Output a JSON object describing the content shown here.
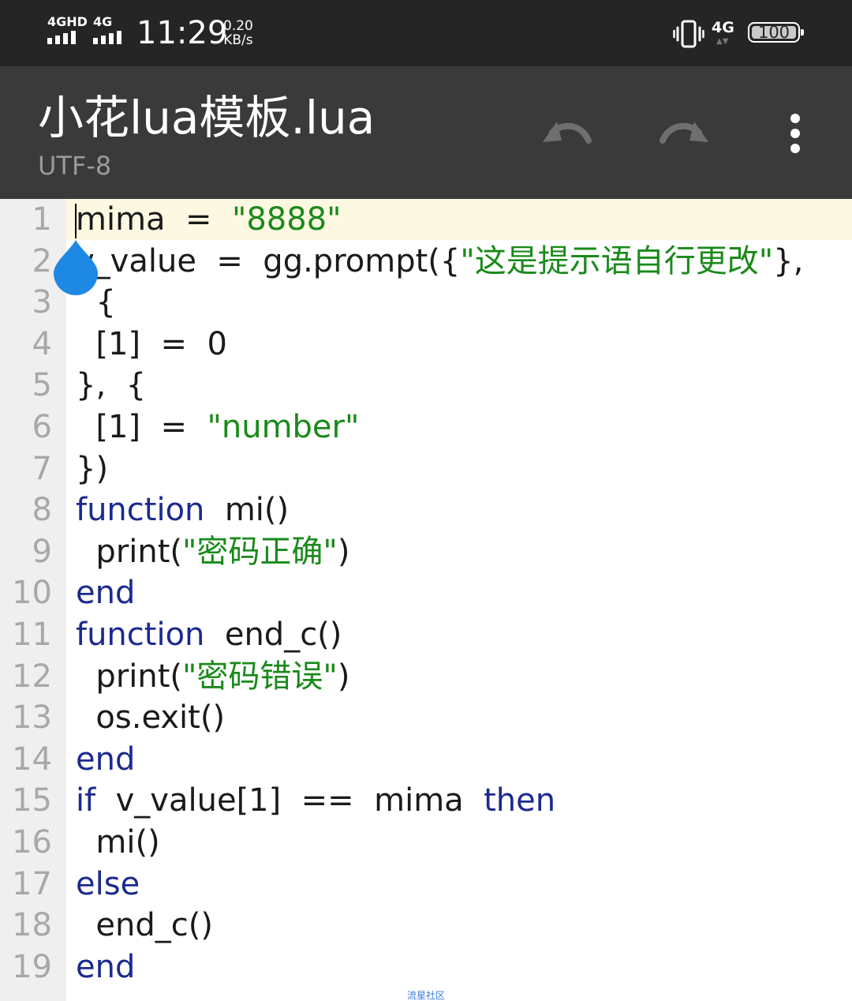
{
  "status_bar": {
    "signal1": "4GHD",
    "signal2": "4G",
    "time": "11:29",
    "speed_value": "0.20",
    "speed_unit": "KB/s",
    "network": "4G",
    "battery": "100"
  },
  "toolbar": {
    "title": "小花lua模板.lua",
    "encoding": "UTF-8",
    "undo_icon": "undo-icon",
    "redo_icon": "redo-icon",
    "more_icon": "more-vert-icon"
  },
  "editor": {
    "current_line": 1,
    "lines": [
      {
        "n": "1",
        "tokens": [
          {
            "t": "mima  =  ",
            "c": "plain"
          },
          {
            "t": "\"8888\"",
            "c": "str"
          }
        ]
      },
      {
        "n": "2",
        "tokens": [
          {
            "t": "v_value  =  gg.prompt({",
            "c": "plain"
          },
          {
            "t": "\"这是提示语自行更改\"",
            "c": "str"
          },
          {
            "t": "},",
            "c": "plain"
          }
        ]
      },
      {
        "n": "3",
        "tokens": [
          {
            "t": "  {",
            "c": "plain"
          }
        ]
      },
      {
        "n": "4",
        "tokens": [
          {
            "t": "  [1]  =  0",
            "c": "plain"
          }
        ]
      },
      {
        "n": "5",
        "tokens": [
          {
            "t": "},  {",
            "c": "plain"
          }
        ]
      },
      {
        "n": "6",
        "tokens": [
          {
            "t": "  [1]  =  ",
            "c": "plain"
          },
          {
            "t": "\"number\"",
            "c": "str"
          }
        ]
      },
      {
        "n": "7",
        "tokens": [
          {
            "t": "})",
            "c": "plain"
          }
        ]
      },
      {
        "n": "8",
        "tokens": [
          {
            "t": "function",
            "c": "kw"
          },
          {
            "t": "  mi()",
            "c": "plain"
          }
        ]
      },
      {
        "n": "9",
        "tokens": [
          {
            "t": "  print(",
            "c": "plain"
          },
          {
            "t": "\"密码正确\"",
            "c": "str"
          },
          {
            "t": ")",
            "c": "plain"
          }
        ]
      },
      {
        "n": "10",
        "tokens": [
          {
            "t": "end",
            "c": "kw"
          }
        ]
      },
      {
        "n": "11",
        "tokens": [
          {
            "t": "function",
            "c": "kw"
          },
          {
            "t": "  end_c()",
            "c": "plain"
          }
        ]
      },
      {
        "n": "12",
        "tokens": [
          {
            "t": "  print(",
            "c": "plain"
          },
          {
            "t": "\"密码错误\"",
            "c": "str"
          },
          {
            "t": ")",
            "c": "plain"
          }
        ]
      },
      {
        "n": "13",
        "tokens": [
          {
            "t": "  os.exit()",
            "c": "plain"
          }
        ]
      },
      {
        "n": "14",
        "tokens": [
          {
            "t": "end",
            "c": "kw"
          }
        ]
      },
      {
        "n": "15",
        "tokens": [
          {
            "t": "if",
            "c": "kw"
          },
          {
            "t": "  v_value[1]  ==  mima  ",
            "c": "plain"
          },
          {
            "t": "then",
            "c": "kw"
          }
        ]
      },
      {
        "n": "16",
        "tokens": [
          {
            "t": "  mi()",
            "c": "plain"
          }
        ]
      },
      {
        "n": "17",
        "tokens": [
          {
            "t": "else",
            "c": "kw"
          }
        ]
      },
      {
        "n": "18",
        "tokens": [
          {
            "t": "  end_c()",
            "c": "plain"
          }
        ]
      },
      {
        "n": "19",
        "tokens": [
          {
            "t": "end",
            "c": "kw"
          }
        ]
      }
    ]
  },
  "watermark": "流星社区",
  "colors": {
    "keyword": "#1b2a8f",
    "string": "#1a8a1a",
    "plain": "#1a1a1a",
    "line_number": "#a8a8a8",
    "current_line_bg": "#fdf8e2",
    "selection_handle": "#1e88e5",
    "toolbar_bg": "#3a3a3a",
    "statusbar_bg": "#252525"
  }
}
